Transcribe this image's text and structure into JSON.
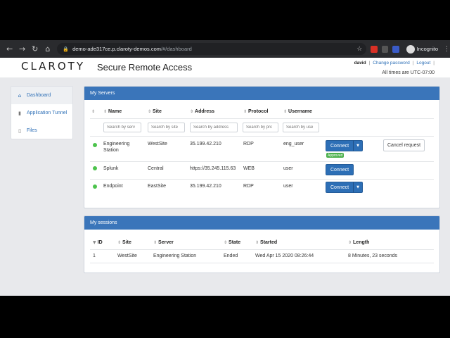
{
  "browser": {
    "url_host": "demo-ade317ce.p.claroty-demos.com",
    "url_path": "/#/dashboard",
    "incognito_label": "Incognito"
  },
  "header": {
    "logo_text": "CLAROTY",
    "app_title": "Secure Remote Access",
    "username": "david",
    "change_password": "Change password",
    "logout": "Logout",
    "timezone_note": "All times are UTC-07:00"
  },
  "sidebar": {
    "items": [
      {
        "label": "Dashboard",
        "icon": "home-icon"
      },
      {
        "label": "Application Tunnel",
        "icon": "tunnel-icon"
      },
      {
        "label": "Files",
        "icon": "file-icon"
      }
    ]
  },
  "servers": {
    "title": "My Servers",
    "columns": [
      "Name",
      "Site",
      "Address",
      "Protocol",
      "Username"
    ],
    "filters": [
      "Search by serv",
      "Search by site",
      "Search by address",
      "Search by prc",
      "Search by use"
    ],
    "rows": [
      {
        "name_line1": "Engineering",
        "name_line2": "Station",
        "site": "WestSite",
        "address": "35.199.42.210",
        "protocol": "RDP",
        "username": "eng_user",
        "connect": "Connect",
        "badge": "Approved",
        "cancel": "Cancel request"
      },
      {
        "name_line1": "Splunk",
        "name_line2": "",
        "site": "Central",
        "address": "https://35.245.115.63",
        "protocol": "WEB",
        "username": "user",
        "connect": "Connect"
      },
      {
        "name_line1": "Endpoint",
        "name_line2": "",
        "site": "EastSite",
        "address": "35.199.42.210",
        "protocol": "RDP",
        "username": "user",
        "connect": "Connect"
      }
    ],
    "status_color": "#4cc34c"
  },
  "sessions": {
    "title": "My sessions",
    "columns": [
      "ID",
      "Site",
      "Server",
      "State",
      "Started",
      "Length"
    ],
    "rows": [
      {
        "id": "1",
        "site": "WestSite",
        "server": "Engineering Station",
        "state": "Ended",
        "started": "Wed Apr 15 2020 08:26:44",
        "length": "8 Minutes, 23 seconds"
      }
    ]
  },
  "colors": {
    "accent": "#3a75ba",
    "button": "#2d6fb6",
    "approved": "#4cb04c"
  }
}
